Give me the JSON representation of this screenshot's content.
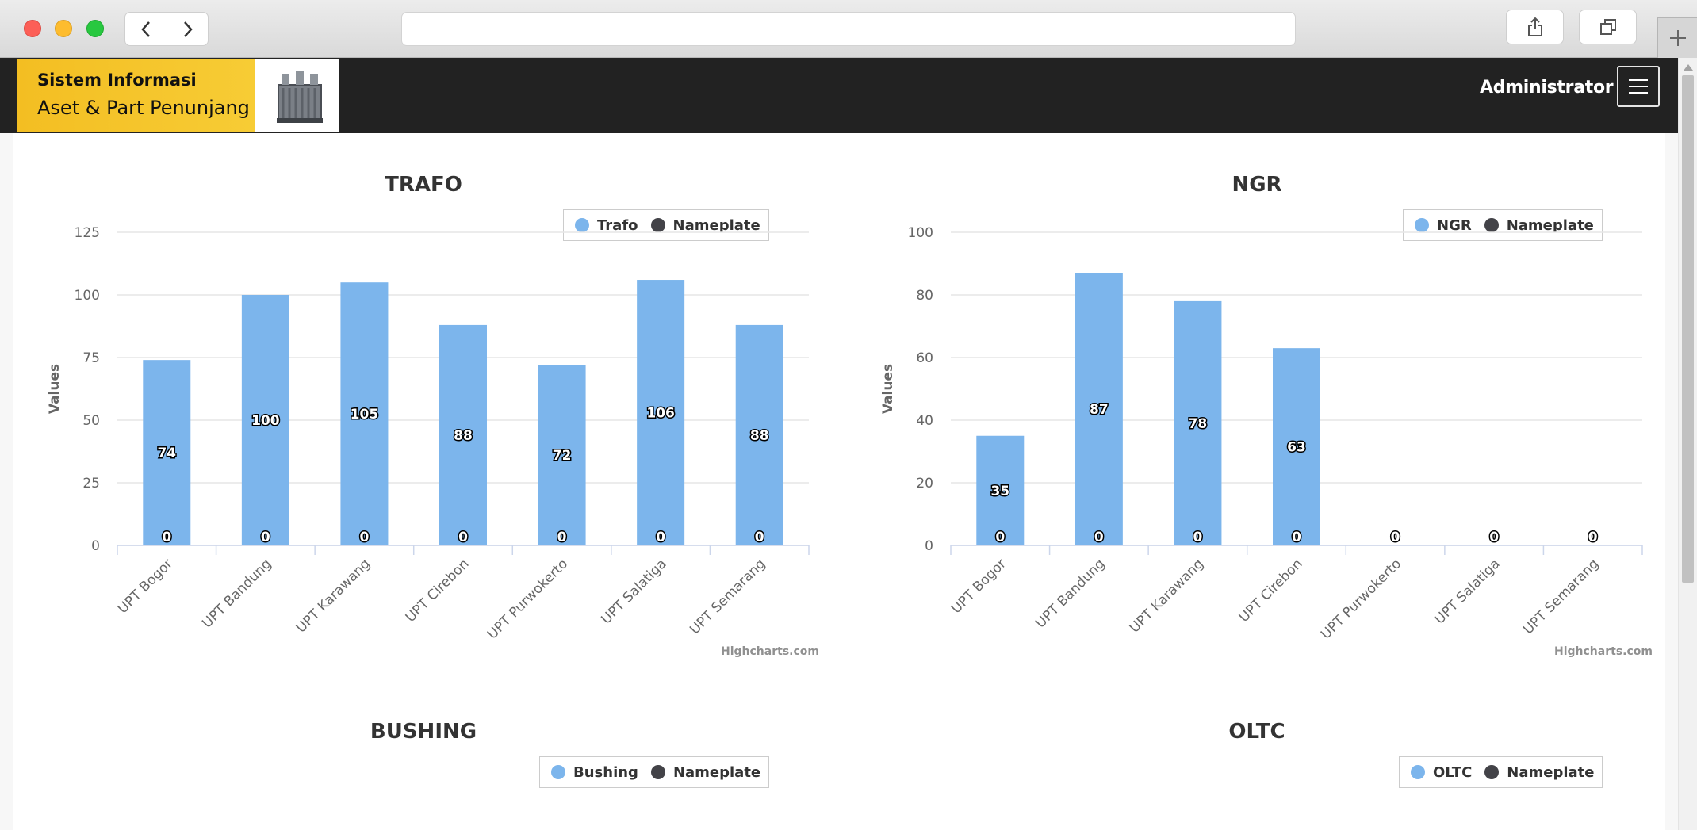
{
  "app": {
    "logo_line1": "Sistem Informasi",
    "logo_line2": "Aset & Part Penunjang",
    "user": "Administrator"
  },
  "colors": {
    "bar": "#7cb5ec",
    "nameplate": "#434348",
    "header": "#222222",
    "brand_yellow": "#f5c22a"
  },
  "credits": "Highcharts.com",
  "chart_data": [
    {
      "id": "trafo",
      "type": "bar",
      "title": "TRAFO",
      "ylabel": "Values",
      "categories": [
        "UPT Bogor",
        "UPT Bandung",
        "UPT Karawang",
        "UPT Cirebon",
        "UPT Purwokerto",
        "UPT Salatiga",
        "UPT Semarang"
      ],
      "ylim": [
        0,
        125
      ],
      "yticks": [
        0,
        25,
        50,
        75,
        100,
        125
      ],
      "series": [
        {
          "name": "Trafo",
          "color": "#7cb5ec",
          "values": [
            74,
            100,
            105,
            88,
            72,
            106,
            88
          ]
        },
        {
          "name": "Nameplate",
          "color": "#434348",
          "values": [
            0,
            0,
            0,
            0,
            0,
            0,
            0
          ]
        }
      ]
    },
    {
      "id": "ngr",
      "type": "bar",
      "title": "NGR",
      "ylabel": "Values",
      "categories": [
        "UPT Bogor",
        "UPT Bandung",
        "UPT Karawang",
        "UPT Cirebon",
        "UPT Purwokerto",
        "UPT Salatiga",
        "UPT Semarang"
      ],
      "ylim": [
        0,
        100
      ],
      "yticks": [
        0,
        20,
        40,
        60,
        80,
        100
      ],
      "series": [
        {
          "name": "NGR",
          "color": "#7cb5ec",
          "values": [
            35,
            87,
            78,
            63,
            0,
            0,
            0
          ]
        },
        {
          "name": "Nameplate",
          "color": "#434348",
          "values": [
            0,
            0,
            0,
            0,
            0,
            0,
            0
          ]
        }
      ]
    },
    {
      "id": "bushing",
      "type": "bar",
      "title": "BUSHING",
      "series": [
        {
          "name": "Bushing",
          "color": "#7cb5ec"
        },
        {
          "name": "Nameplate",
          "color": "#434348"
        }
      ]
    },
    {
      "id": "oltc",
      "type": "bar",
      "title": "OLTC",
      "series": [
        {
          "name": "OLTC",
          "color": "#7cb5ec"
        },
        {
          "name": "Nameplate",
          "color": "#434348"
        }
      ]
    }
  ]
}
